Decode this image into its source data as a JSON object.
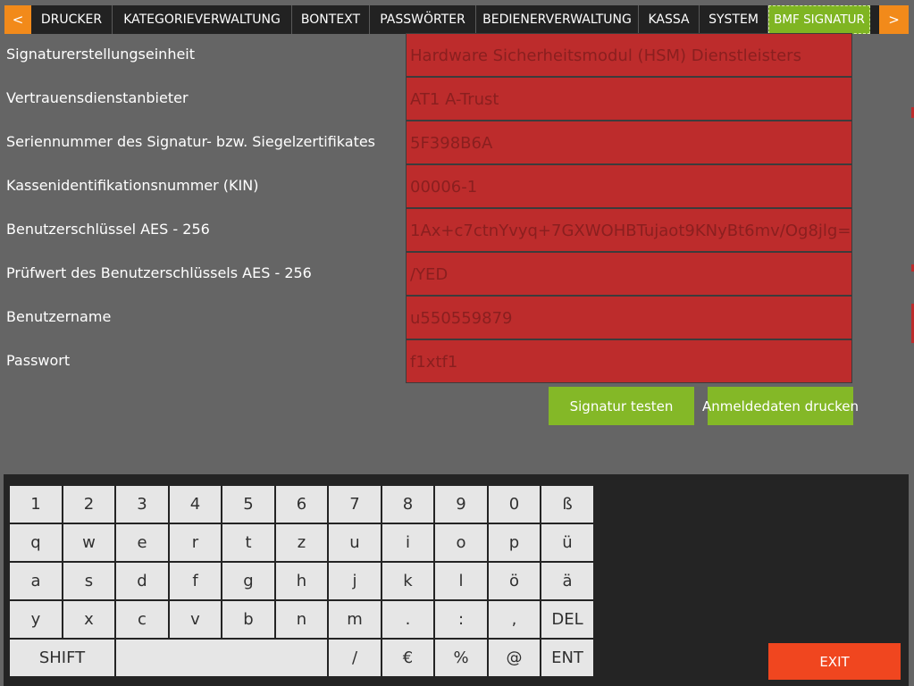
{
  "nav": {
    "prev": "<",
    "next": ">",
    "tabs": [
      {
        "label": "DRUCKER"
      },
      {
        "label": "KATEGORIEVERWALTUNG"
      },
      {
        "label": "BONTEXT"
      },
      {
        "label": "PASSWÖRTER"
      },
      {
        "label": "BEDIENERVERWALTUNG"
      },
      {
        "label": "KASSA"
      },
      {
        "label": "SYSTEM"
      },
      {
        "label": "BMF SIGNATUR"
      }
    ],
    "active_index": 7
  },
  "form": {
    "rows": [
      {
        "label": "Signaturerstellungseinheit",
        "value": "Hardware Sicherheitsmodul (HSM) Dienstleisters"
      },
      {
        "label": "Vertrauensdienstanbieter",
        "value": "AT1 A-Trust"
      },
      {
        "label": "Seriennummer des Signatur- bzw. Siegelzertifikates",
        "value": "5F398B6A"
      },
      {
        "label": "Kassenidentifikationsnummer (KIN)",
        "value": "00006-1"
      },
      {
        "label": "Benutzerschlüssel AES - 256",
        "value": "1Ax+c7ctnYvyq+7GXWOHBTujaot9KNyBt6mv/Og8jlg="
      },
      {
        "label": "Prüfwert des Benutzerschlüssels AES - 256",
        "value": "/YED"
      },
      {
        "label": "Benutzername",
        "value": "u550559879"
      },
      {
        "label": "Passwort",
        "value": "f1xtf1"
      }
    ]
  },
  "actions": {
    "test_signature": "Signatur testen",
    "print_login": "Anmeldedaten drucken"
  },
  "keyboard": {
    "rows": [
      [
        "1",
        "2",
        "3",
        "4",
        "5",
        "6",
        "7",
        "8",
        "9",
        "0",
        "ß"
      ],
      [
        "q",
        "w",
        "e",
        "r",
        "t",
        "z",
        "u",
        "i",
        "o",
        "p",
        "ü"
      ],
      [
        "a",
        "s",
        "d",
        "f",
        "g",
        "h",
        "j",
        "k",
        "l",
        "ö",
        "ä"
      ],
      [
        "y",
        "x",
        "c",
        "v",
        "b",
        "n",
        "m",
        ".",
        ":",
        ",",
        "DEL"
      ],
      [
        "SHIFT",
        "",
        "/",
        "€",
        "%",
        "@",
        "ENT"
      ]
    ]
  },
  "exit_label": "EXIT",
  "colors": {
    "background": "#656565",
    "tab_active": "#7fb522",
    "arrow": "#f28a1a",
    "field": "#bd2c2c",
    "field_text": "#8a1f1f",
    "button": "#84b827",
    "exit": "#f0461f"
  }
}
